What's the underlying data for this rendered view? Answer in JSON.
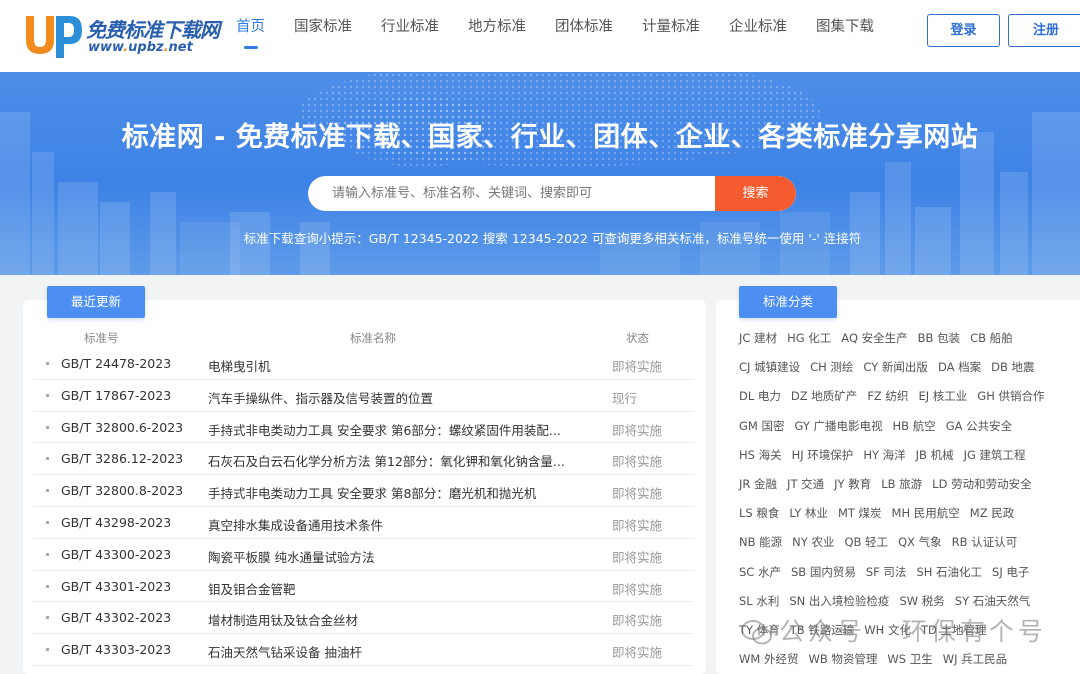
{
  "header": {
    "logo_title": "免费标准下载网",
    "logo_url_part1": "www",
    "logo_url_part2": "upbz",
    "logo_url_part3": "net",
    "nav": [
      "首页",
      "国家标准",
      "行业标准",
      "地方标准",
      "团体标准",
      "计量标准",
      "企业标准",
      "图集下载"
    ],
    "login_label": "登录",
    "register_label": "注册",
    "accent_color": "#2f7de1"
  },
  "banner": {
    "title": "标准网 - 免费标准下载、国家、行业、团体、企业、各类标准分享网站",
    "search_placeholder": "请输入标准号、标准名称、关键词、搜索即可",
    "search_button": "搜索",
    "tip": "标准下载查询小提示：GB/T 12345-2022 搜索 12345-2022 可查询更多相关标准，标准号统一使用 '-' 连接符"
  },
  "recent": {
    "tab_label": "最近更新",
    "columns": [
      "标准号",
      "标准名称",
      "状态"
    ],
    "rows": [
      {
        "code": "GB/T 24478-2023",
        "name": "电梯曳引机",
        "status": "即将实施"
      },
      {
        "code": "GB/T 17867-2023",
        "name": "汽车手操纵件、指示器及信号装置的位置",
        "status": "现行"
      },
      {
        "code": "GB/T 32800.6-2023",
        "name": "手持式非电类动力工具 安全要求 第6部分：螺纹紧固件用装配...",
        "status": "即将实施"
      },
      {
        "code": "GB/T 3286.12-2023",
        "name": "石灰石及白云石化学分析方法 第12部分：氧化钾和氧化钠含量...",
        "status": "即将实施"
      },
      {
        "code": "GB/T 32800.8-2023",
        "name": "手持式非电类动力工具 安全要求 第8部分：磨光机和抛光机",
        "status": "即将实施"
      },
      {
        "code": "GB/T 43298-2023",
        "name": "真空排水集成设备通用技术条件",
        "status": "即将实施"
      },
      {
        "code": "GB/T 43300-2023",
        "name": "陶瓷平板膜 纯水通量试验方法",
        "status": "即将实施"
      },
      {
        "code": "GB/T 43301-2023",
        "name": "钼及钼合金管靶",
        "status": "即将实施"
      },
      {
        "code": "GB/T 43302-2023",
        "name": "增材制造用钛及钛合金丝材",
        "status": "即将实施"
      },
      {
        "code": "GB/T 43303-2023",
        "name": "石油天然气钻采设备 抽油杆",
        "status": "即将实施"
      }
    ]
  },
  "categories": {
    "tab_label": "标准分类",
    "rows": [
      [
        "JC 建材",
        "HG 化工",
        "AQ 安全生产",
        "BB 包装",
        "CB 船舶"
      ],
      [
        "CJ 城镇建设",
        "CH 测绘",
        "CY 新闻出版",
        "DA 档案",
        "DB 地震"
      ],
      [
        "DL 电力",
        "DZ 地质矿产",
        "FZ 纺织",
        "EJ 核工业",
        "GH 供销合作"
      ],
      [
        "GM 国密",
        "GY 广播电影电视",
        "HB 航空",
        "GA 公共安全"
      ],
      [
        "HS 海关",
        "HJ 环境保护",
        "HY 海洋",
        "JB 机械",
        "JG 建筑工程"
      ],
      [
        "JR 金融",
        "JT 交通",
        "JY 教育",
        "LB 旅游",
        "LD 劳动和劳动安全"
      ],
      [
        "LS 粮食",
        "LY 林业",
        "MT 煤炭",
        "MH 民用航空",
        "MZ 民政"
      ],
      [
        "NB 能源",
        "NY 农业",
        "QB 轻工",
        "QX 气象",
        "RB 认证认可"
      ],
      [
        "SC 水产",
        "SB 国内贸易",
        "SF 司法",
        "SH 石油化工",
        "SJ 电子"
      ],
      [
        "SL 水利",
        "SN 出入境检验检疫",
        "SW 税务",
        "SY 石油天然气"
      ],
      [
        "TY 体育",
        "TB 铁路运输",
        "WH 文化",
        "TD 土地管理"
      ],
      [
        "WM 外经贸",
        "WB 物资管理",
        "WS 卫生",
        "WJ 兵工民品"
      ]
    ]
  },
  "watermark": "公众号 · 环保有个号"
}
